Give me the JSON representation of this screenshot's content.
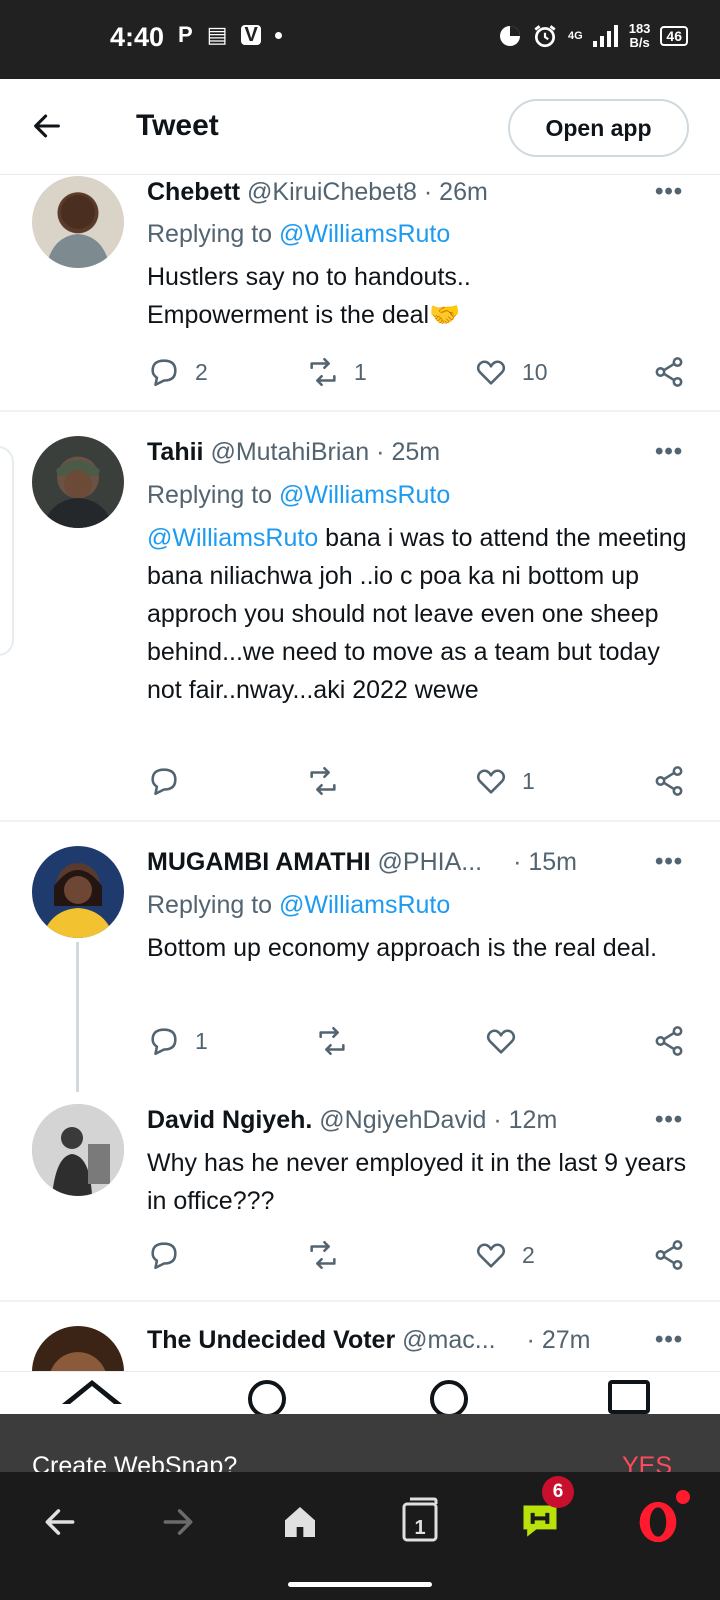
{
  "status_bar": {
    "time": "4:40",
    "network_speed_value": "183",
    "network_speed_unit": "B/s",
    "network_type": "4G",
    "battery": "46"
  },
  "header": {
    "title": "Tweet",
    "open_app_label": "Open app"
  },
  "tweets": [
    {
      "name": "Chebett",
      "handle": "@KiruiChebet8",
      "time": "· 26m",
      "replying_prefix": "Replying to",
      "replying_to": "@WilliamsRuto",
      "body": "Hustlers say no to handouts..\nEmpowerment is the deal🤝",
      "replies": "2",
      "retweets": "1",
      "likes": "10"
    },
    {
      "name": "Tahii",
      "handle": "@MutahiBrian",
      "time": "· 25m",
      "replying_prefix": "Replying to",
      "replying_to": "@WilliamsRuto",
      "body_mention": "@WilliamsRuto",
      "body": " bana i was to attend the meeting bana niliachwa joh ..io c poa ka ni bottom up approch you should not leave even one sheep behind...we need to move as a team but today not fair..nway...aki 2022 wewe",
      "replies": "",
      "retweets": "",
      "likes": "1"
    },
    {
      "name": "MUGAMBI AMATHI",
      "handle": "@PHIA...",
      "time": "· 15m",
      "replying_prefix": "Replying to",
      "replying_to": "@WilliamsRuto",
      "body": "Bottom up economy approach is the real deal.",
      "replies": "1",
      "retweets": "",
      "likes": ""
    },
    {
      "name": "David Ngiyeh.",
      "handle": "@NgiyehDavid",
      "time": "· 12m",
      "body": "Why has he never employed it in the last 9 years in office???",
      "replies": "",
      "retweets": "",
      "likes": "2"
    },
    {
      "name": "The Undecided Voter",
      "handle": "@mac...",
      "time": "· 27m"
    }
  ],
  "websnap": {
    "prompt": "Create WebSnap?",
    "yes": "YES"
  },
  "browser_bar": {
    "tab_count": "1",
    "notification_count": "6"
  },
  "colors": {
    "link": "#1d9bf0",
    "muted": "#536471",
    "accent_red": "#ff1b2d",
    "speed_dial_green": "#b9e20a"
  }
}
